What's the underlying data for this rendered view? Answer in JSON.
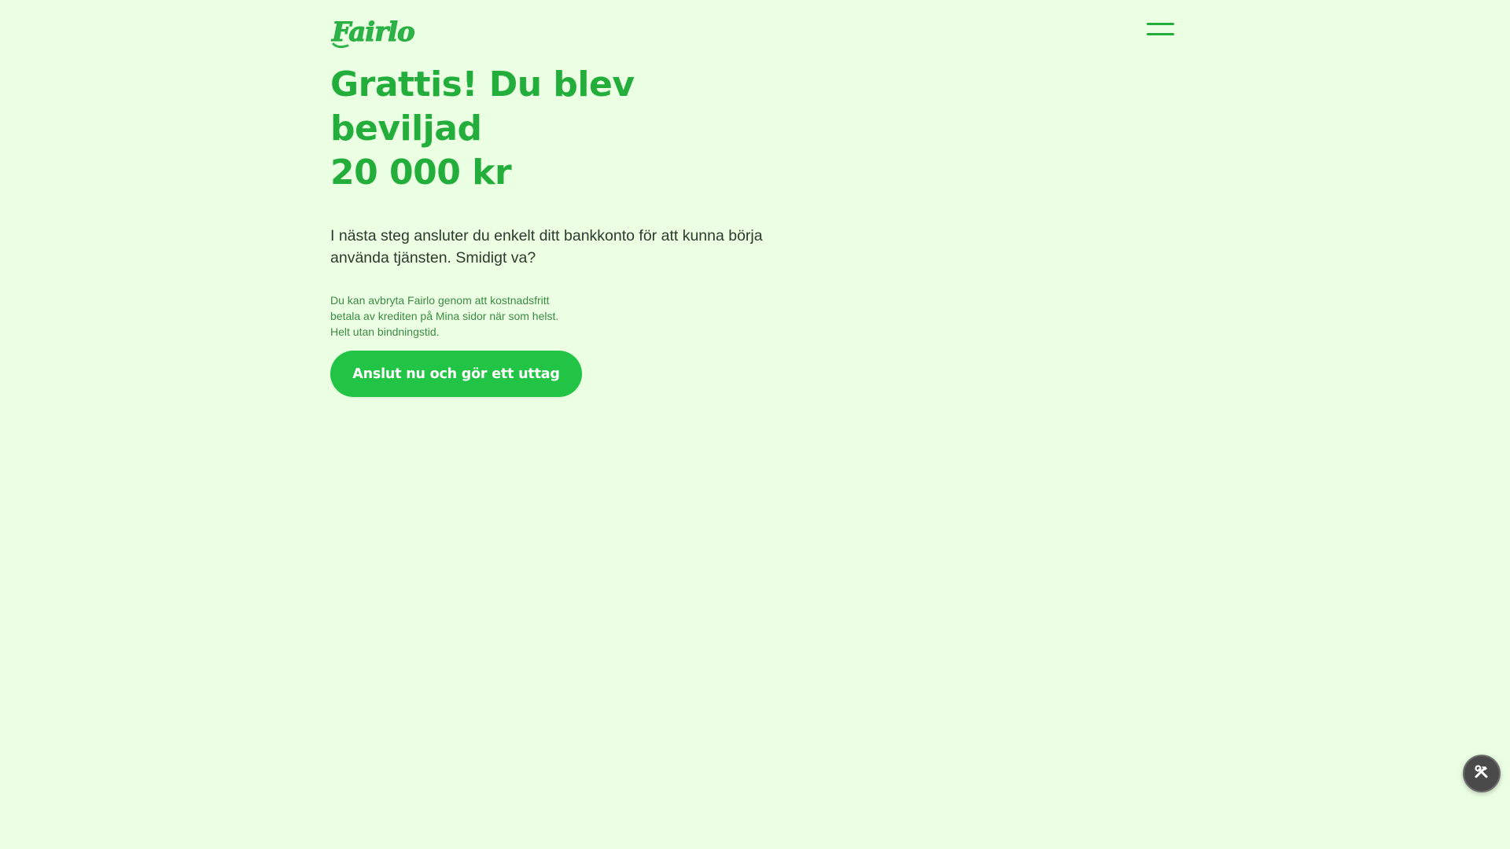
{
  "header": {
    "logo_text": "Fairlo",
    "menu_icon": "hamburger-menu-icon"
  },
  "main": {
    "headline_line1": "Grattis! Du blev beviljad",
    "headline_line2": "20 000 kr",
    "lead": "I nästa steg ansluter du enkelt ditt bankkonto för att kunna börja använda tjänsten. Smidigt va?",
    "small_print_line1": "Du kan avbryta Fairlo genom att kostnadsfritt",
    "small_print_line2": "betala av krediten på Mina sidor när som helst.",
    "small_print_line3": "Helt utan bindningstid.",
    "cta_label": "Anslut nu och gör ett uttag"
  },
  "floating": {
    "tools_icon": "hammer-wrench-icon"
  },
  "colors": {
    "background": "#ebffe3",
    "brand_green": "#23ad3b",
    "button_green": "#21c444",
    "fab_gray": "#4a4a4a"
  }
}
